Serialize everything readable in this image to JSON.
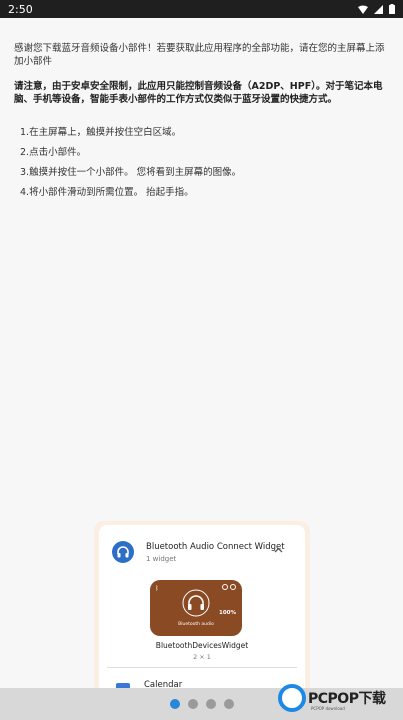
{
  "status_bar": {
    "time": "2:50"
  },
  "content": {
    "intro": "感谢您下载蓝牙音频设备小部件！若要获取此应用程序的全部功能，请在您的主屏幕上添加小部件",
    "notice": "请注意，由于安卓安全限制，此应用只能控制音频设备（A2DP、HPF）。对于笔记本电脑、手机等设备，智能手表小部件的工作方式仅类似于蓝牙设置的快捷方式。",
    "steps": [
      "1.在主屏幕上，触摸并按住空白区域。",
      "2.点击小部件。",
      "3.触摸并按住一个小部件。 您将看到主屏幕的图像。",
      "4.将小部件滑动到所需位置。 抬起手指。"
    ]
  },
  "widget_sheet": {
    "app_name": "Bluetooth Audio Connect Widget",
    "app_count": "1 widget",
    "widget_label": "Bluetooth audio",
    "widget_battery": "100%",
    "widget_name": "BluetoothDevicesWidget",
    "widget_size": "2 × 1",
    "next_app_name": "Calendar"
  },
  "pager": {
    "pages": 4,
    "active_index": 0
  },
  "watermark": {
    "text": "PCPOP下载",
    "sub": "PCPOP download"
  },
  "colors": {
    "status_bar_bg": "#1f1f1f",
    "sheet_bg": "#fbeee2",
    "widget_bg": "#8a4a24",
    "accent": "#2a87d8"
  }
}
